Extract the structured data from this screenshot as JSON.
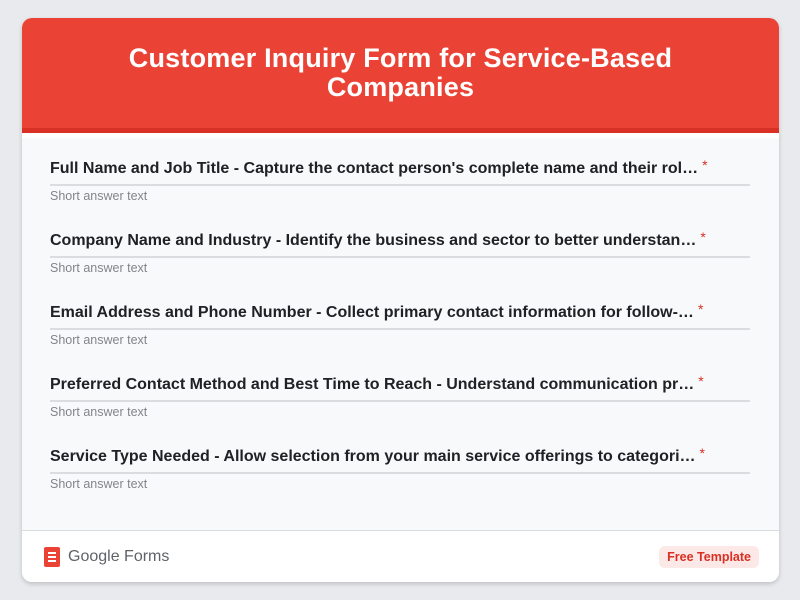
{
  "form": {
    "title": "Customer Inquiry Form for Service-Based Companies"
  },
  "questions": [
    {
      "label": "Full Name and Job Title - Capture the contact person's complete name and their rol…",
      "required_marker": "*",
      "placeholder": "Short answer text"
    },
    {
      "label": "Company Name and Industry - Identify the business and sector to better understan…",
      "required_marker": "*",
      "placeholder": "Short answer text"
    },
    {
      "label": "Email Address and Phone Number - Collect primary contact information for follow-…",
      "required_marker": "*",
      "placeholder": "Short answer text"
    },
    {
      "label": "Preferred Contact Method and Best Time to Reach - Understand communication pr…",
      "required_marker": "*",
      "placeholder": "Short answer text"
    },
    {
      "label": "Service Type Needed - Allow selection from your main service offerings to categori…",
      "required_marker": "*",
      "placeholder": "Short answer text"
    }
  ],
  "footer": {
    "brand_icon": "google-forms-icon",
    "brand_label": "Google Forms",
    "badge": "Free Template"
  },
  "colors": {
    "header": "#ea4335",
    "header_border": "#d93025",
    "required": "#d93025",
    "background": "#e8eaed"
  }
}
